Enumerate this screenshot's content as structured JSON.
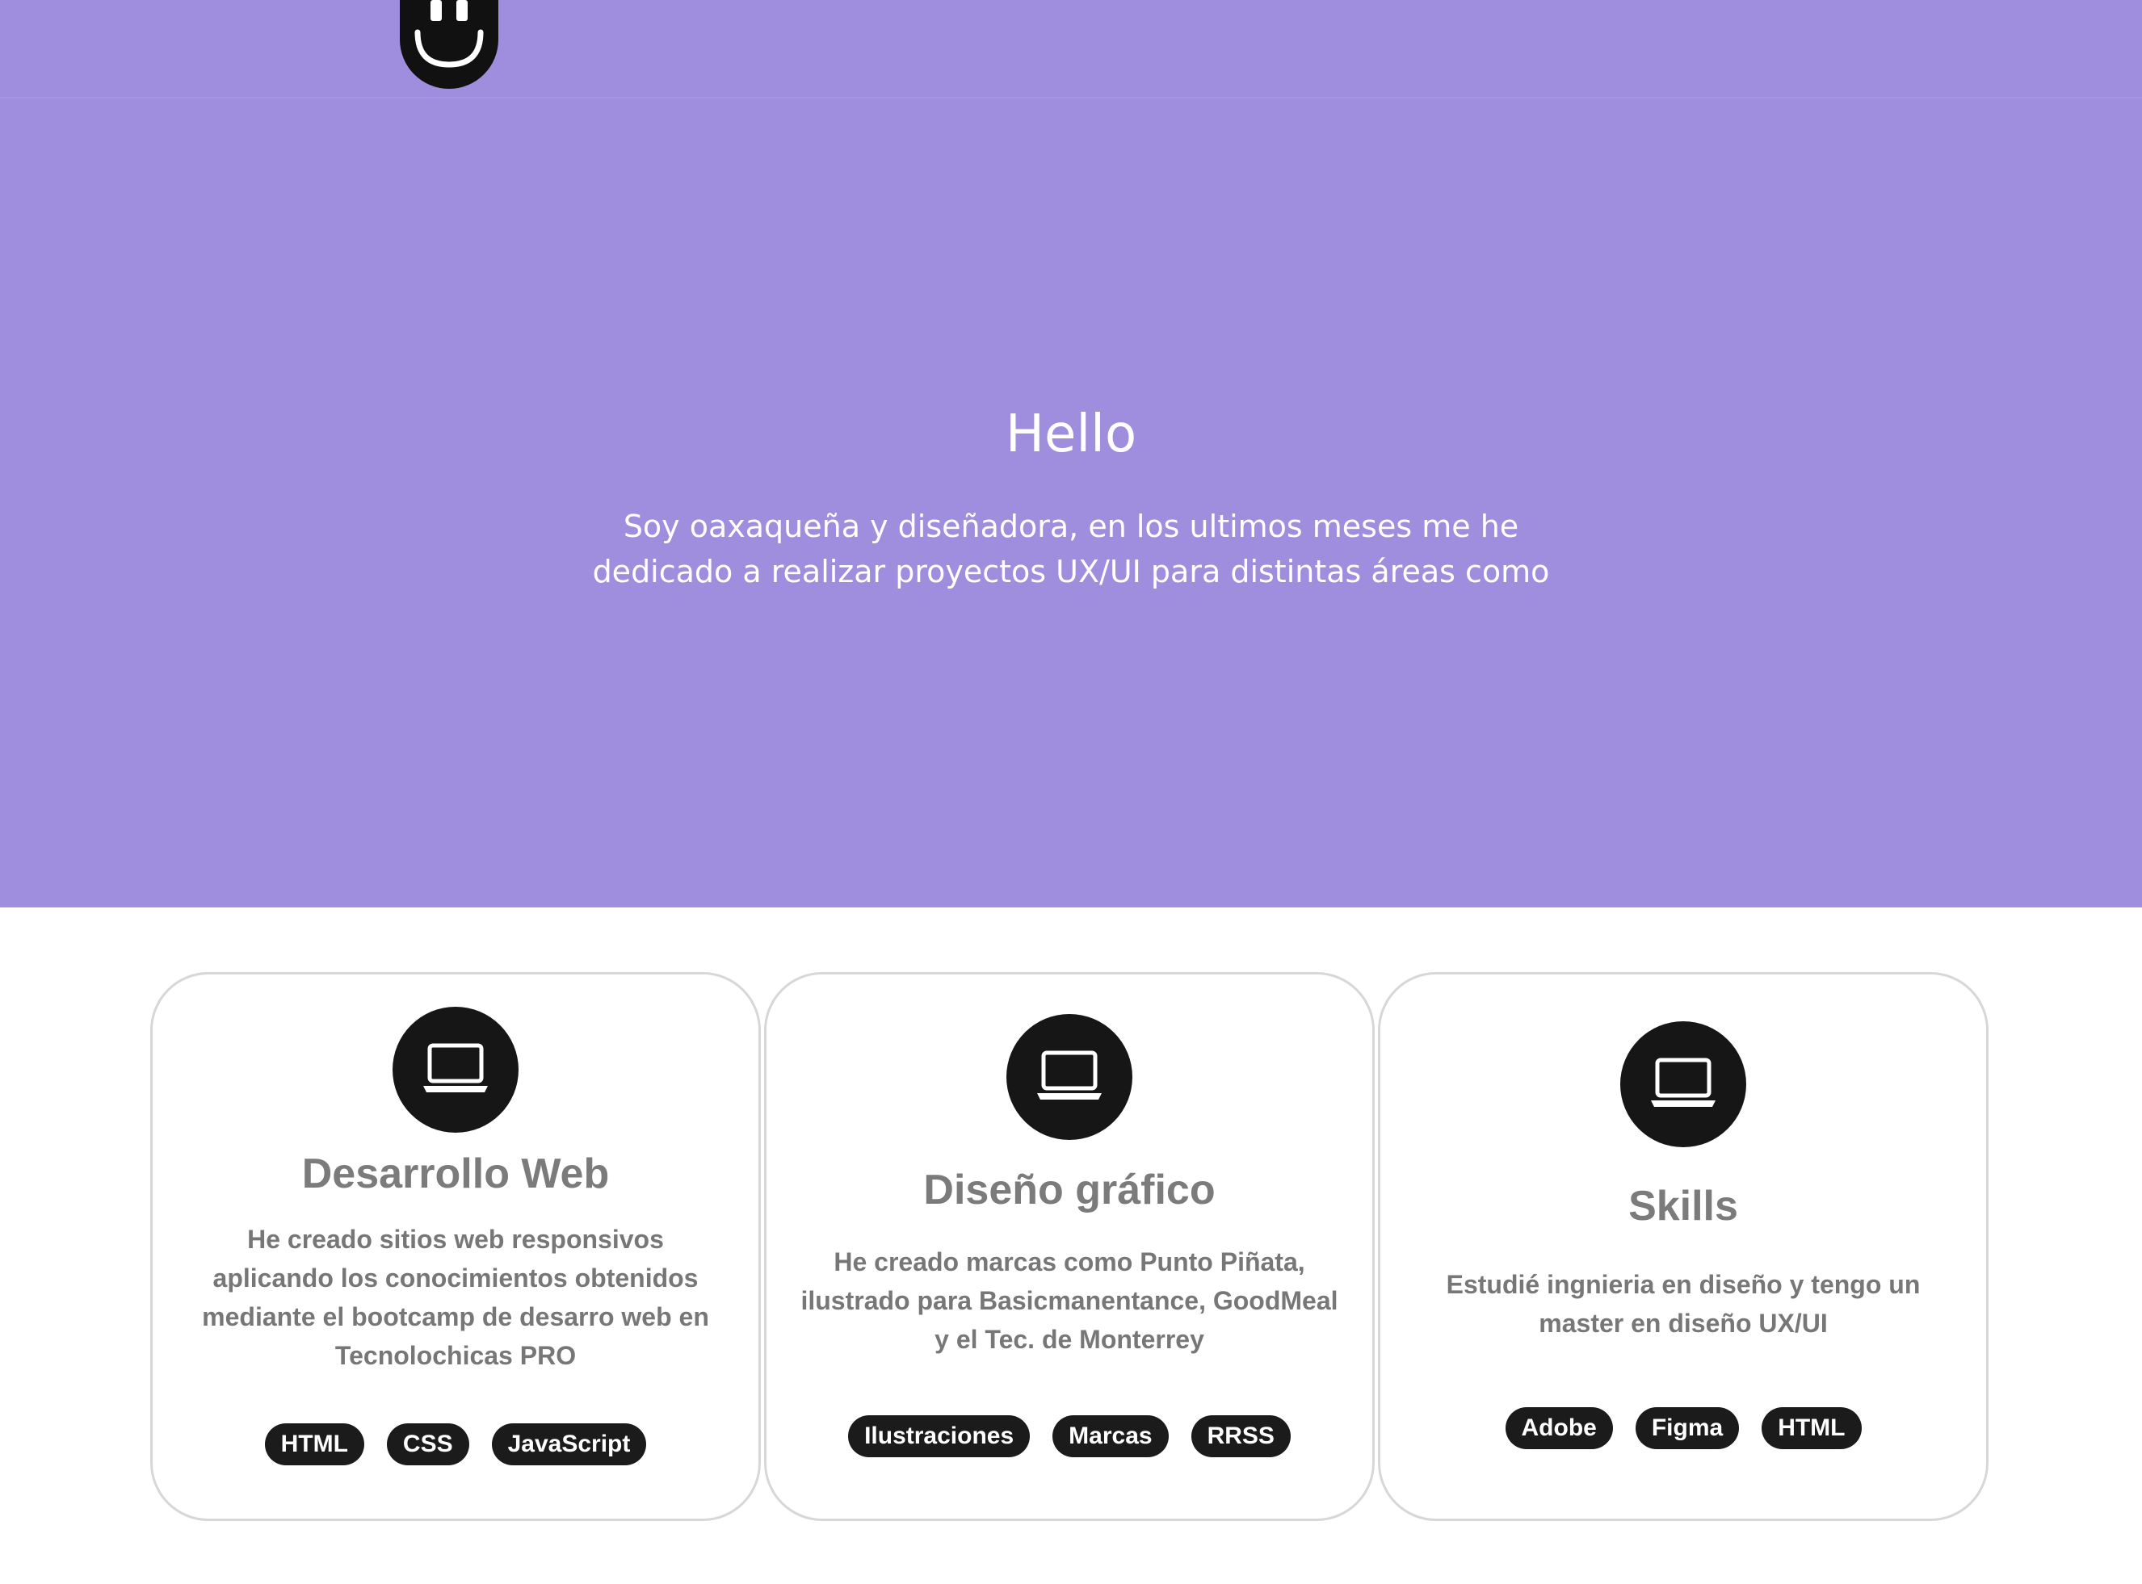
{
  "colors": {
    "hero_background": "#9f8ddd",
    "card_border": "#d7d7d7",
    "icon_circle": "#161616",
    "tag_background": "#1b1b1b",
    "text_muted": "#777777"
  },
  "header": {
    "logo_icon": "smiley-logo-icon"
  },
  "hero": {
    "title": "Hello",
    "text": "Soy oaxaqueña y diseñadora, en los ultimos meses me he dedicado a realizar proyectos UX/UI para distintas áreas como"
  },
  "cards": [
    {
      "icon": "laptop-icon",
      "title": "Desarrollo Web",
      "text": "He creado sitios web responsivos aplicando los conocimientos obtenidos mediante el bootcamp de desarro web en Tecnolochicas PRO",
      "tags": [
        "HTML",
        "CSS",
        "JavaScript"
      ]
    },
    {
      "icon": "laptop-icon",
      "title": "Diseño gráfico",
      "text": "He creado marcas como Punto Piñata, ilustrado para Basicmanentance, GoodMeal y el Tec. de Monterrey",
      "tags": [
        "Ilustraciones",
        "Marcas",
        "RRSS"
      ]
    },
    {
      "icon": "laptop-icon",
      "title": "Skills",
      "text": "Estudié ingnieria en diseño y tengo un master en diseño UX/UI",
      "tags": [
        "Adobe",
        "Figma",
        "HTML"
      ]
    }
  ]
}
